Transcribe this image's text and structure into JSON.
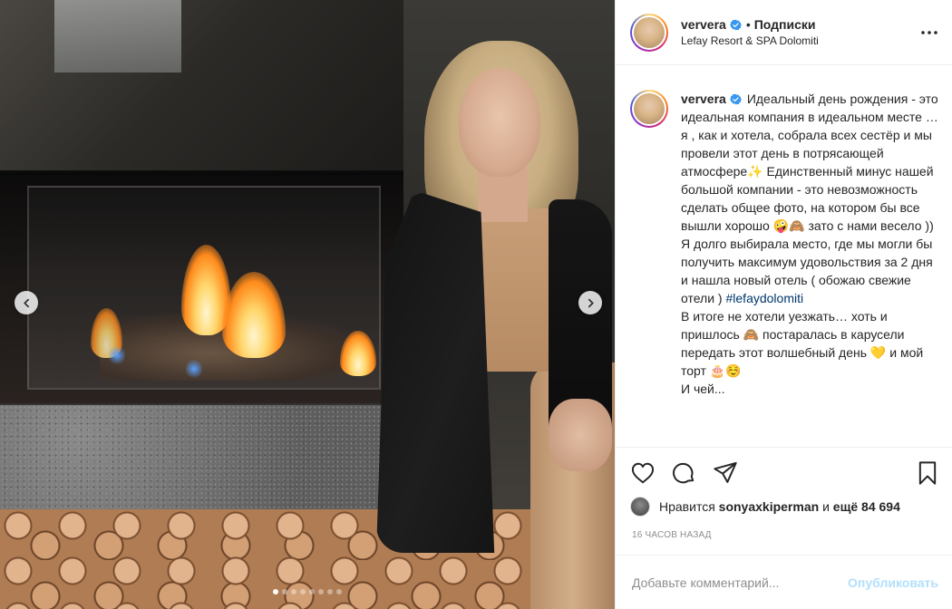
{
  "header": {
    "username": "ververa",
    "separator": "•",
    "follow_label": "Подписки",
    "location": "Lefay Resort & SPA Dolomiti"
  },
  "caption": {
    "username": "ververa",
    "text_before_hashtag": "Идеальный день рождения - это идеальная компания в идеальном месте … я , как и хотела, собрала всех сестёр и мы провели этот день в потрясающей атмосфере✨ Единственный минус нашей большой компании - это невозможность сделать общее фото, на котором бы все вышли хорошо 🤪🙈 зато с нами весело ))\nЯ долго выбирала место, где мы могли бы получить максимум удовольствия за 2 дня и нашла новый отель ( обожаю свежие отели ) ",
    "hashtag": "#lefaydolomiti",
    "text_after_hashtag": "\nВ итоге не хотели уезжать… хоть и пришлось 🙈 постаралась в карусели передать этот волшебный день 💛 и мой торт 🎂☺️\nИ чей..."
  },
  "likes": {
    "prefix": "Нравится",
    "user": "sonyaxkiperman",
    "middle": "и",
    "others": "ещё 84 694"
  },
  "timestamp": "16 часов назад",
  "comment": {
    "placeholder": "Добавьте комментарий...",
    "publish_label": "Опубликовать"
  },
  "carousel": {
    "total_slides": 8,
    "active_slide": 1
  },
  "icons": {
    "verified": "verified-badge-icon",
    "more": "more-options-icon",
    "like": "heart-icon",
    "comment": "comment-bubble-icon",
    "share": "paper-plane-icon",
    "save": "bookmark-icon",
    "prev": "chevron-left-icon",
    "next": "chevron-right-icon"
  },
  "colors": {
    "verified_blue": "#3897f0",
    "link_blue": "#00376b",
    "publish_disabled": "#b2dffc",
    "secondary_text": "#8e8e8e"
  }
}
